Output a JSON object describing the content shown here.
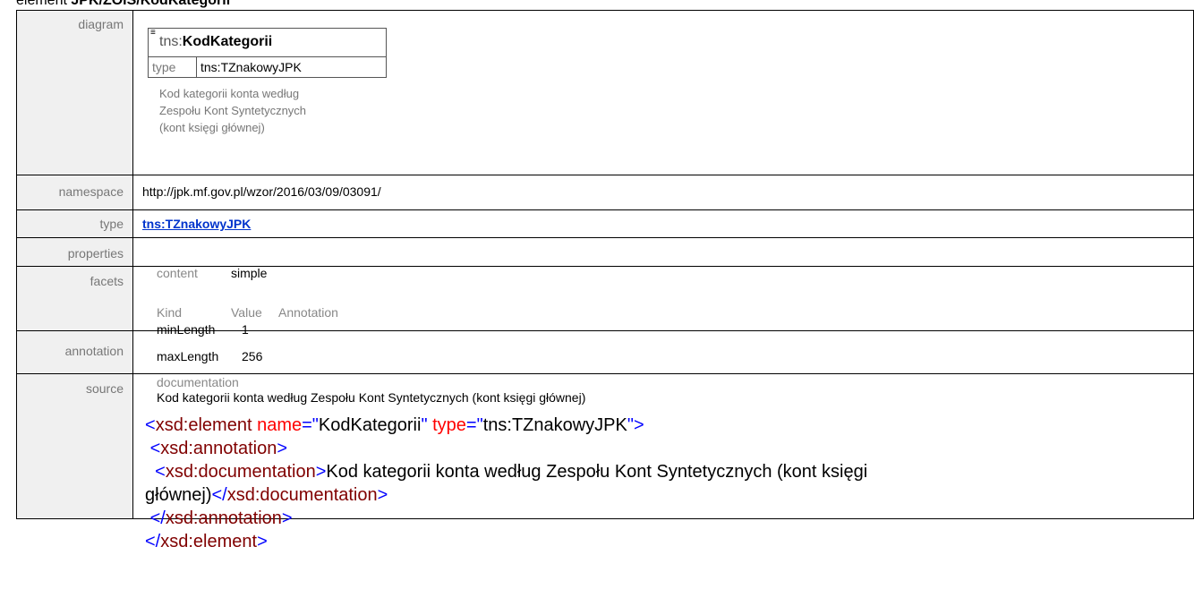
{
  "heading": {
    "prefix": "element ",
    "bold": "JPK/ZOiS/KodKategorii"
  },
  "labels": {
    "diagram": "diagram",
    "namespace": "namespace",
    "type": "type",
    "properties": "properties",
    "facets": "facets",
    "annotation": "annotation",
    "source": "source"
  },
  "diagram": {
    "prefix": "tns:",
    "name": "KodKategorii",
    "type_key": "type",
    "type_value": "tns:TZnakowyJPK",
    "doc_lines": [
      "Kod kategorii konta według",
      "Zespołu Kont Syntetycznych",
      "(kont księgi głównej)"
    ]
  },
  "namespace": "http://jpk.mf.gov.pl/wzor/2016/03/09/03091/",
  "type_link": "tns:TZnakowyJPK",
  "properties": {
    "key": "content",
    "value": "simple"
  },
  "facets": {
    "headers": [
      "Kind",
      "Value",
      "Annotation"
    ],
    "rows": [
      {
        "kind": "minLength",
        "value": "1"
      },
      {
        "kind": "maxLength",
        "value": "256"
      }
    ]
  },
  "annotation": {
    "key": "documentation",
    "value": "Kod kategorii konta według Zespołu Kont Syntetycznych (kont księgi głównej)"
  },
  "source": {
    "el_open": "xsd:element",
    "attr_name": "name",
    "val_name": "KodKategorii",
    "attr_type": "type",
    "val_type": "tns:TZnakowyJPK",
    "annotation_tag": "xsd:annotation",
    "documentation_tag": "xsd:documentation",
    "doc_text_1": "Kod kategorii konta według Zespołu Kont Syntetycznych (kont księgi",
    "doc_text_2": "głównej)"
  }
}
